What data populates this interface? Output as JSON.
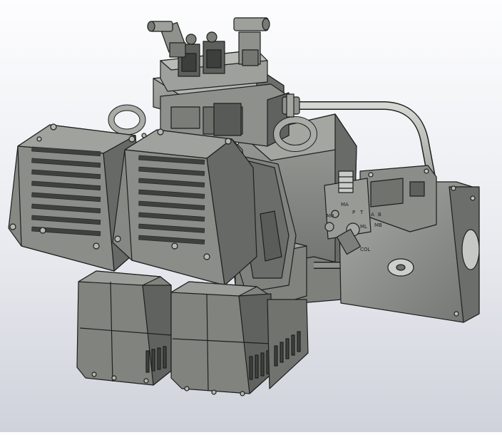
{
  "colors": {
    "background_top": "#fdfdfe",
    "background_bottom": "#cfd2da",
    "body_metal": "#878a86",
    "body_metal_light": "#a6a9a4",
    "body_metal_dark": "#5d605c",
    "edge_lines": "#1e201e",
    "tube": "#b6b9b3"
  },
  "labels": {
    "port_a": "A",
    "port_b": "B",
    "port_p": "P",
    "port_t": "T",
    "port_ma": "MA",
    "port_mb": "MB",
    "port_mp": "MP",
    "port_ml": "ML",
    "port_col": "COL"
  }
}
